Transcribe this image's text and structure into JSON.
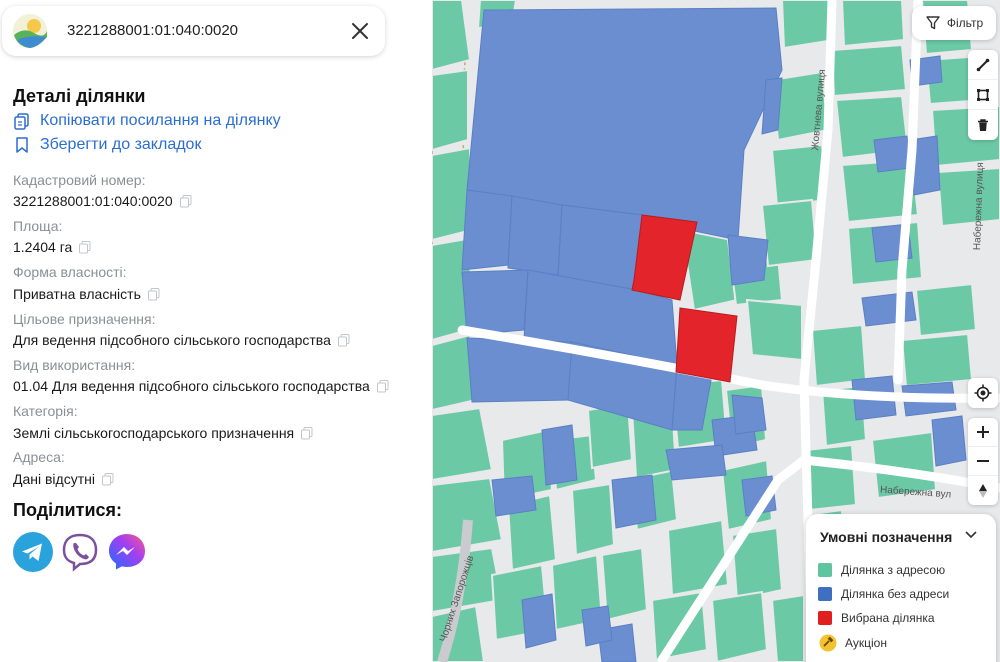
{
  "search": {
    "value": "3221288001:01:040:0020"
  },
  "details": {
    "title": "Деталі ділянки",
    "copy_link": "Копіювати посилання на ділянку",
    "save_bookmark": "Зберегти до закладок",
    "fields": [
      {
        "label": "Кадастровий номер:",
        "value": "3221288001:01:040:0020"
      },
      {
        "label": "Площа:",
        "value": "1.2404 га"
      },
      {
        "label": "Форма власності:",
        "value": "Приватна власність"
      },
      {
        "label": "Цільове призначення:",
        "value": "Для ведення підсобного сільського господарства"
      },
      {
        "label": "Вид використання:",
        "value": "01.04 Для ведення підсобного сільського господарства"
      },
      {
        "label": "Категорія:",
        "value": "Землі сільськогосподарського призначення"
      },
      {
        "label": "Адреса:",
        "value": "Дані відсутні"
      }
    ]
  },
  "share": {
    "title": "Поділитися:"
  },
  "map": {
    "filter_label": "Фільтр",
    "streets": [
      "Жовтнева вулиця",
      "Набережна вулиця",
      "Набережна вул",
      "Чорних Запорожців"
    ],
    "legend": {
      "title": "Умовні позначення",
      "items": [
        {
          "label": "Ділянка з адресою",
          "color": "#5fc4a0"
        },
        {
          "label": "Ділянка без адреси",
          "color": "#3f6fbf"
        },
        {
          "label": "Вибрана ділянка",
          "color": "#e0201f"
        },
        {
          "label": "Аукціон",
          "color": "#f2c230"
        }
      ]
    },
    "colors": {
      "with_address": "#6cc9a6",
      "without_address": "#6a8ed0",
      "selected": "#e3242b"
    }
  }
}
